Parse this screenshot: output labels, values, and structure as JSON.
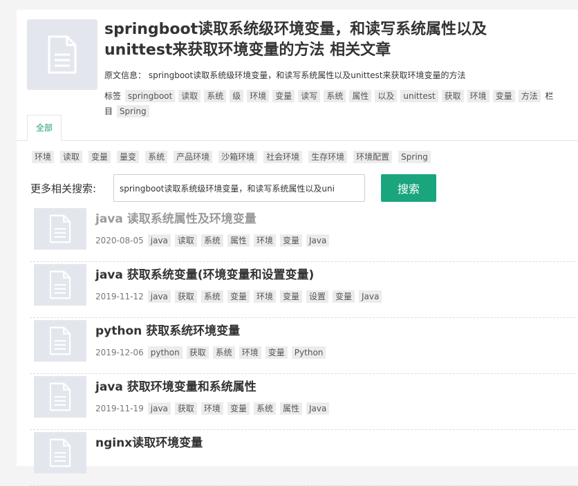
{
  "article": {
    "title": "springboot读取系统级环境变量，和读写系统属性以及unittest来获取环境变量的方法 相关文章",
    "source_label": "原文信息：",
    "source_text": "springboot读取系统级环境变量，和读写系统属性以及unittest来获取环境变量的方法",
    "tags_label": "标签",
    "tags": [
      "springboot",
      "读取",
      "系统",
      "级",
      "环境",
      "变量",
      "读写",
      "系统",
      "属性",
      "以及",
      "unittest",
      "获取",
      "环境",
      "变量",
      "方法"
    ],
    "column_label": "栏目",
    "columns": [
      "Spring"
    ]
  },
  "tabs": [
    {
      "label": "全部"
    }
  ],
  "tag_cloud": [
    "环境",
    "读取",
    "变量",
    "量变",
    "系统",
    "产品环境",
    "沙箱环境",
    "社会环境",
    "生存环境",
    "环境配置",
    "Spring"
  ],
  "search": {
    "label": "更多相关搜索:",
    "value": "springboot读取系统级环境变量，和读写系统属性以及uni",
    "button": "搜索"
  },
  "results": [
    {
      "title": "java 读取系统属性及环境变量",
      "date": "2020-08-05",
      "tags": [
        "java",
        "读取",
        "系统",
        "属性",
        "环境",
        "变量",
        "Java"
      ],
      "faded": true
    },
    {
      "title": "java 获取系统变量(环境变量和设置变量)",
      "date": "2019-11-12",
      "tags": [
        "java",
        "获取",
        "系统",
        "变量",
        "环境",
        "变量",
        "设置",
        "变量",
        "Java"
      ],
      "faded": false
    },
    {
      "title": "python 获取系统环境变量",
      "date": "2019-12-06",
      "tags": [
        "python",
        "获取",
        "系统",
        "环境",
        "变量",
        "Python"
      ],
      "faded": false
    },
    {
      "title": "java 获取环境变量和系统属性",
      "date": "2019-11-19",
      "tags": [
        "java",
        "获取",
        "环境",
        "变量",
        "系统",
        "属性",
        "Java"
      ],
      "faded": false
    },
    {
      "title": "nginx读取环境变量",
      "date": "",
      "tags": [],
      "faded": false
    }
  ],
  "colors": {
    "accent": "#1aa57f",
    "tag_bg": "#ececec",
    "thumb_bg": "#e3e7ed"
  },
  "icons": {
    "thumbnail": "document-icon"
  }
}
